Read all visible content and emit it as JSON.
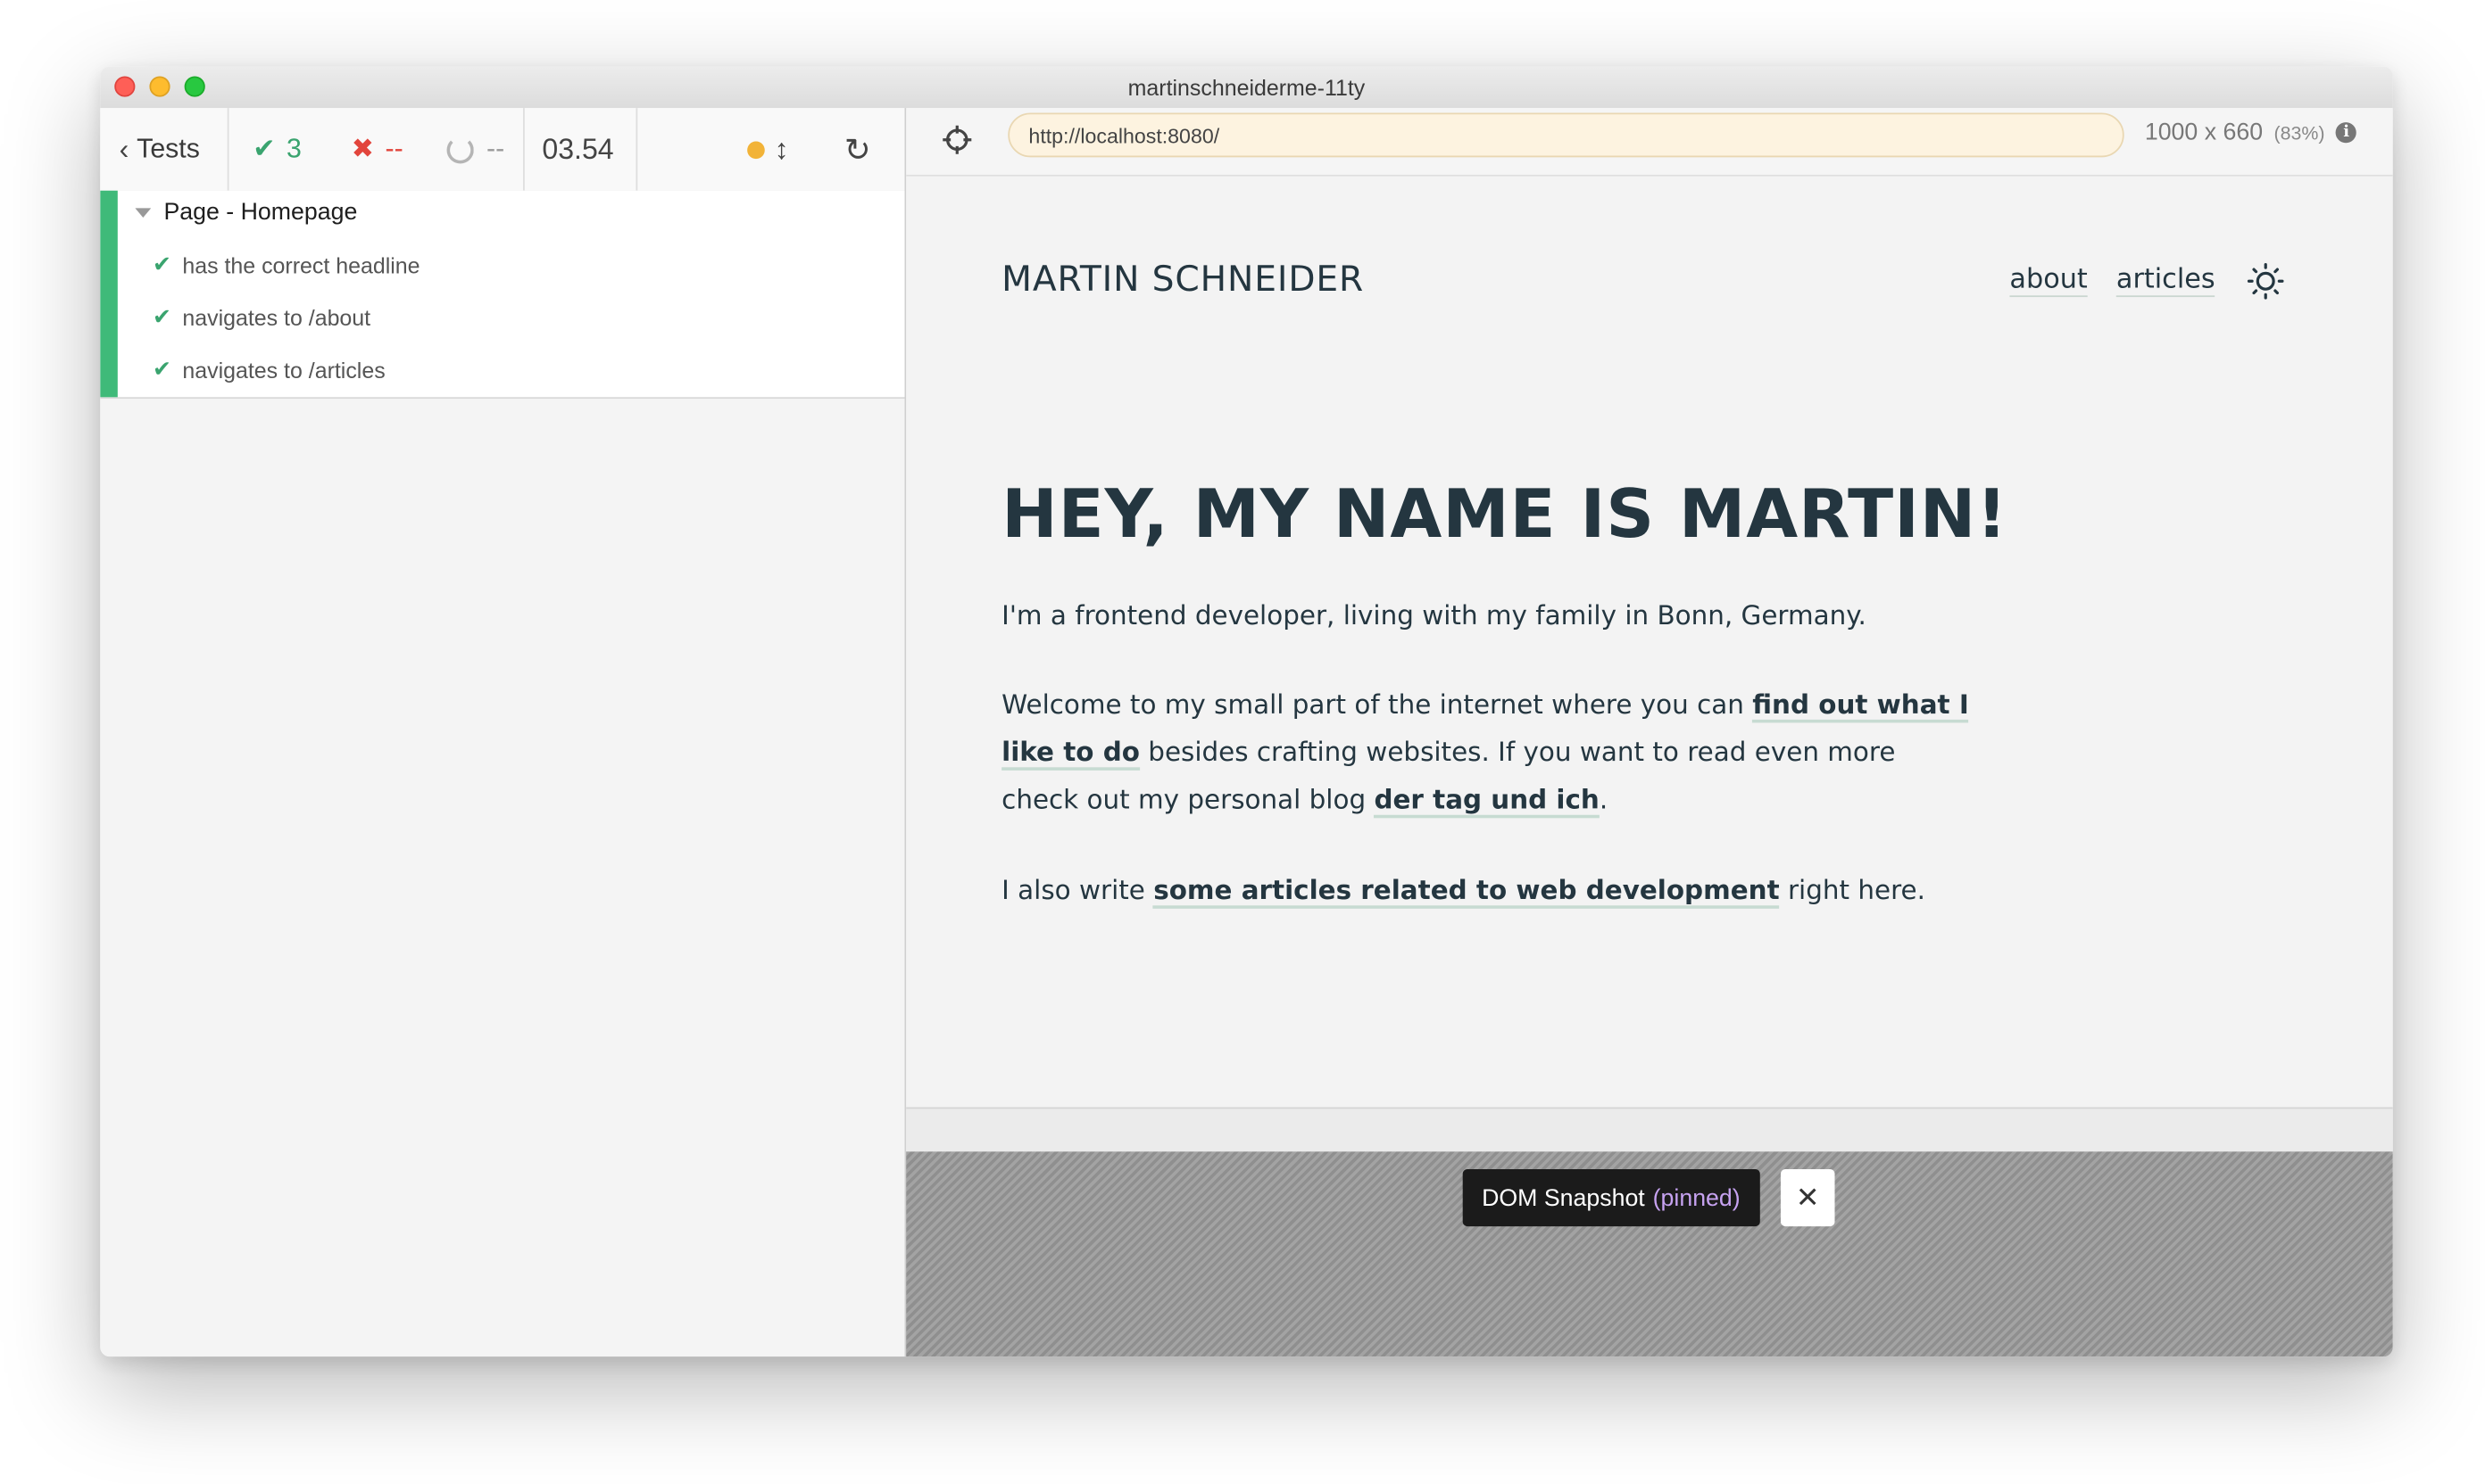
{
  "window": {
    "title": "martinschneiderme-11ty"
  },
  "reporter": {
    "tests_label": "Tests",
    "passed_count": "3",
    "failed_count": "--",
    "pending_count": "--",
    "duration": "03.54",
    "status_color": "#f2b338",
    "suite": {
      "title": "Page - Homepage",
      "tests": [
        {
          "title": "has the correct headline",
          "state": "passed"
        },
        {
          "title": "navigates to /about",
          "state": "passed"
        },
        {
          "title": "navigates to /articles",
          "state": "passed"
        }
      ]
    }
  },
  "aut": {
    "url": "http://localhost:8080/",
    "viewport": "1000 x 660",
    "zoom": "(83%)",
    "snapshot": {
      "label": "DOM Snapshot",
      "state": "(pinned)"
    }
  },
  "site": {
    "logo": "MARTIN SCHNEIDER",
    "nav": [
      "about",
      "articles"
    ],
    "theme_icon": "sun-icon",
    "headline": "HEY, MY NAME IS MARTIN!",
    "p1": "I'm a frontend developer, living with my family in Bonn, Germany.",
    "p2_a": "Welcome to my small part of the internet where you can ",
    "p2_link1": "find out what I like to do",
    "p2_b": " besides crafting websites. If you want to read even more check out my personal blog ",
    "p2_link2": "der tag und ich",
    "p2_c": ".",
    "p3_a": "I also write ",
    "p3_link": "some articles related to web development",
    "p3_b": " right here."
  },
  "colors": {
    "pass": "#3aa46f",
    "fail": "#e2453c",
    "accent_bar": "#3fba79",
    "url_bg": "#fdf3e0"
  }
}
